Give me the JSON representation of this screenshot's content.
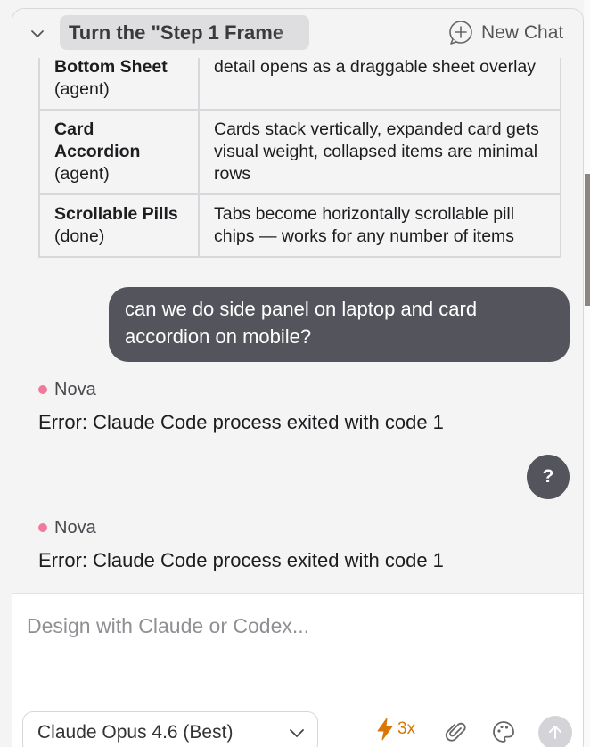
{
  "header": {
    "title": "Turn the \"Step 1 Frame",
    "new_chat_label": "New Chat"
  },
  "options_table": {
    "rows": [
      {
        "name": "Bottom Sheet",
        "tag": "(agent)",
        "description": "detail opens as a draggable sheet overlay"
      },
      {
        "name": "Card Accordion",
        "tag": "(agent)",
        "description": "Cards stack vertically, expanded card gets visual weight, collapsed items are minimal rows"
      },
      {
        "name": "Scrollable Pills",
        "tag": "(done)",
        "description": "Tabs become horizontally scrollable pill chips — works for any number of items"
      }
    ]
  },
  "messages": {
    "user_message": "can we do side panel on laptop and card accordion on mobile?",
    "assistant_1": {
      "author": "Nova",
      "text": "Error: Claude Code process exited with code 1"
    },
    "user_question": "?",
    "assistant_2": {
      "author": "Nova",
      "text": "Error: Claude Code process exited with code 1"
    }
  },
  "composer": {
    "placeholder": "Design with Claude or Codex...",
    "model": "Claude Opus 4.6 (Best)",
    "boost_label": "3x"
  },
  "colors": {
    "author_dot": "#ef7a9c",
    "user_bubble": "#54545c",
    "boost": "#d97706"
  },
  "icons": {
    "collapse": "chevron-down-icon",
    "new_chat": "plus-circle-icon",
    "boost": "lightning-icon",
    "attach": "paperclip-icon",
    "theme": "palette-icon",
    "send": "arrow-up-icon"
  }
}
